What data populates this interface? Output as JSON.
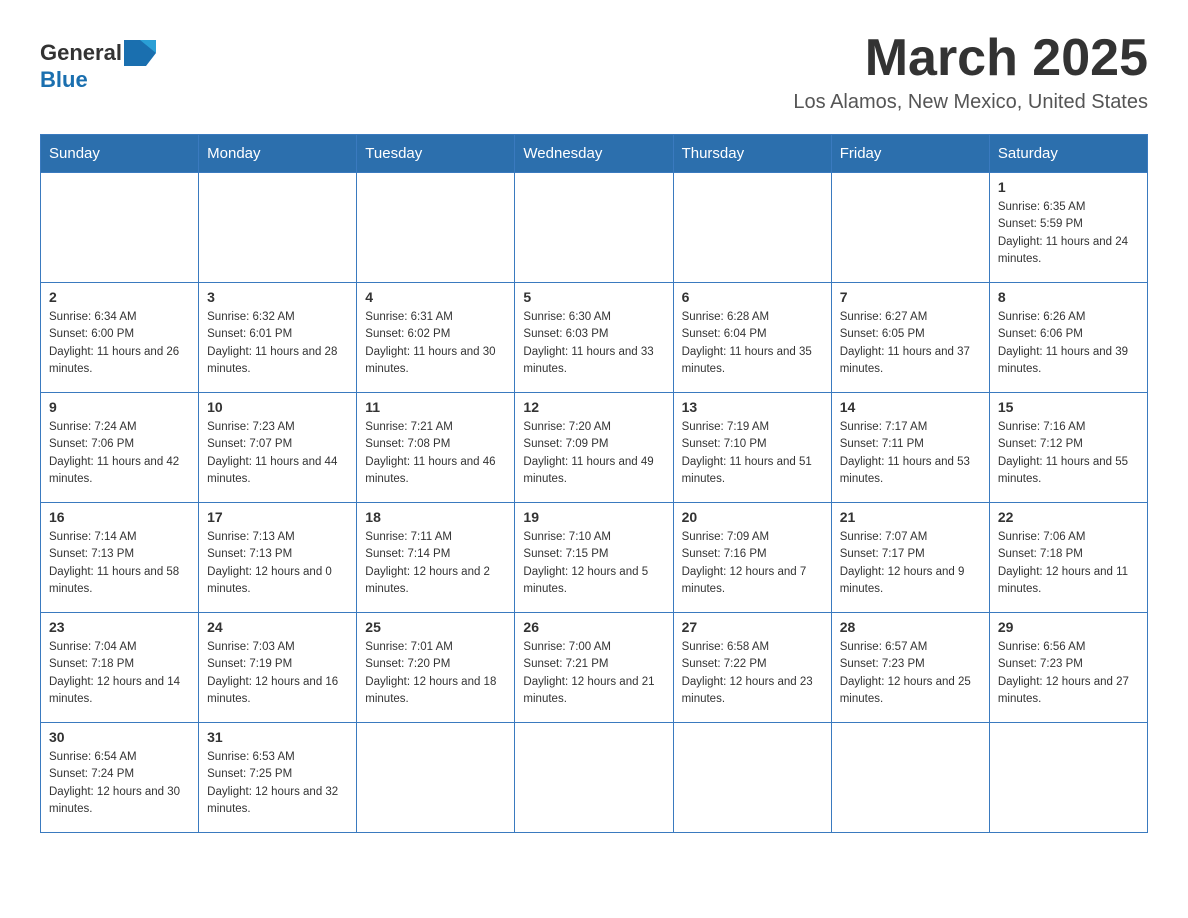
{
  "header": {
    "logo_general": "General",
    "logo_blue": "Blue",
    "month": "March 2025",
    "location": "Los Alamos, New Mexico, United States"
  },
  "weekdays": [
    "Sunday",
    "Monday",
    "Tuesday",
    "Wednesday",
    "Thursday",
    "Friday",
    "Saturday"
  ],
  "weeks": [
    [
      {
        "day": "",
        "sunrise": "",
        "sunset": "",
        "daylight": ""
      },
      {
        "day": "",
        "sunrise": "",
        "sunset": "",
        "daylight": ""
      },
      {
        "day": "",
        "sunrise": "",
        "sunset": "",
        "daylight": ""
      },
      {
        "day": "",
        "sunrise": "",
        "sunset": "",
        "daylight": ""
      },
      {
        "day": "",
        "sunrise": "",
        "sunset": "",
        "daylight": ""
      },
      {
        "day": "",
        "sunrise": "",
        "sunset": "",
        "daylight": ""
      },
      {
        "day": "1",
        "sunrise": "Sunrise: 6:35 AM",
        "sunset": "Sunset: 5:59 PM",
        "daylight": "Daylight: 11 hours and 24 minutes."
      }
    ],
    [
      {
        "day": "2",
        "sunrise": "Sunrise: 6:34 AM",
        "sunset": "Sunset: 6:00 PM",
        "daylight": "Daylight: 11 hours and 26 minutes."
      },
      {
        "day": "3",
        "sunrise": "Sunrise: 6:32 AM",
        "sunset": "Sunset: 6:01 PM",
        "daylight": "Daylight: 11 hours and 28 minutes."
      },
      {
        "day": "4",
        "sunrise": "Sunrise: 6:31 AM",
        "sunset": "Sunset: 6:02 PM",
        "daylight": "Daylight: 11 hours and 30 minutes."
      },
      {
        "day": "5",
        "sunrise": "Sunrise: 6:30 AM",
        "sunset": "Sunset: 6:03 PM",
        "daylight": "Daylight: 11 hours and 33 minutes."
      },
      {
        "day": "6",
        "sunrise": "Sunrise: 6:28 AM",
        "sunset": "Sunset: 6:04 PM",
        "daylight": "Daylight: 11 hours and 35 minutes."
      },
      {
        "day": "7",
        "sunrise": "Sunrise: 6:27 AM",
        "sunset": "Sunset: 6:05 PM",
        "daylight": "Daylight: 11 hours and 37 minutes."
      },
      {
        "day": "8",
        "sunrise": "Sunrise: 6:26 AM",
        "sunset": "Sunset: 6:06 PM",
        "daylight": "Daylight: 11 hours and 39 minutes."
      }
    ],
    [
      {
        "day": "9",
        "sunrise": "Sunrise: 7:24 AM",
        "sunset": "Sunset: 7:06 PM",
        "daylight": "Daylight: 11 hours and 42 minutes."
      },
      {
        "day": "10",
        "sunrise": "Sunrise: 7:23 AM",
        "sunset": "Sunset: 7:07 PM",
        "daylight": "Daylight: 11 hours and 44 minutes."
      },
      {
        "day": "11",
        "sunrise": "Sunrise: 7:21 AM",
        "sunset": "Sunset: 7:08 PM",
        "daylight": "Daylight: 11 hours and 46 minutes."
      },
      {
        "day": "12",
        "sunrise": "Sunrise: 7:20 AM",
        "sunset": "Sunset: 7:09 PM",
        "daylight": "Daylight: 11 hours and 49 minutes."
      },
      {
        "day": "13",
        "sunrise": "Sunrise: 7:19 AM",
        "sunset": "Sunset: 7:10 PM",
        "daylight": "Daylight: 11 hours and 51 minutes."
      },
      {
        "day": "14",
        "sunrise": "Sunrise: 7:17 AM",
        "sunset": "Sunset: 7:11 PM",
        "daylight": "Daylight: 11 hours and 53 minutes."
      },
      {
        "day": "15",
        "sunrise": "Sunrise: 7:16 AM",
        "sunset": "Sunset: 7:12 PM",
        "daylight": "Daylight: 11 hours and 55 minutes."
      }
    ],
    [
      {
        "day": "16",
        "sunrise": "Sunrise: 7:14 AM",
        "sunset": "Sunset: 7:13 PM",
        "daylight": "Daylight: 11 hours and 58 minutes."
      },
      {
        "day": "17",
        "sunrise": "Sunrise: 7:13 AM",
        "sunset": "Sunset: 7:13 PM",
        "daylight": "Daylight: 12 hours and 0 minutes."
      },
      {
        "day": "18",
        "sunrise": "Sunrise: 7:11 AM",
        "sunset": "Sunset: 7:14 PM",
        "daylight": "Daylight: 12 hours and 2 minutes."
      },
      {
        "day": "19",
        "sunrise": "Sunrise: 7:10 AM",
        "sunset": "Sunset: 7:15 PM",
        "daylight": "Daylight: 12 hours and 5 minutes."
      },
      {
        "day": "20",
        "sunrise": "Sunrise: 7:09 AM",
        "sunset": "Sunset: 7:16 PM",
        "daylight": "Daylight: 12 hours and 7 minutes."
      },
      {
        "day": "21",
        "sunrise": "Sunrise: 7:07 AM",
        "sunset": "Sunset: 7:17 PM",
        "daylight": "Daylight: 12 hours and 9 minutes."
      },
      {
        "day": "22",
        "sunrise": "Sunrise: 7:06 AM",
        "sunset": "Sunset: 7:18 PM",
        "daylight": "Daylight: 12 hours and 11 minutes."
      }
    ],
    [
      {
        "day": "23",
        "sunrise": "Sunrise: 7:04 AM",
        "sunset": "Sunset: 7:18 PM",
        "daylight": "Daylight: 12 hours and 14 minutes."
      },
      {
        "day": "24",
        "sunrise": "Sunrise: 7:03 AM",
        "sunset": "Sunset: 7:19 PM",
        "daylight": "Daylight: 12 hours and 16 minutes."
      },
      {
        "day": "25",
        "sunrise": "Sunrise: 7:01 AM",
        "sunset": "Sunset: 7:20 PM",
        "daylight": "Daylight: 12 hours and 18 minutes."
      },
      {
        "day": "26",
        "sunrise": "Sunrise: 7:00 AM",
        "sunset": "Sunset: 7:21 PM",
        "daylight": "Daylight: 12 hours and 21 minutes."
      },
      {
        "day": "27",
        "sunrise": "Sunrise: 6:58 AM",
        "sunset": "Sunset: 7:22 PM",
        "daylight": "Daylight: 12 hours and 23 minutes."
      },
      {
        "day": "28",
        "sunrise": "Sunrise: 6:57 AM",
        "sunset": "Sunset: 7:23 PM",
        "daylight": "Daylight: 12 hours and 25 minutes."
      },
      {
        "day": "29",
        "sunrise": "Sunrise: 6:56 AM",
        "sunset": "Sunset: 7:23 PM",
        "daylight": "Daylight: 12 hours and 27 minutes."
      }
    ],
    [
      {
        "day": "30",
        "sunrise": "Sunrise: 6:54 AM",
        "sunset": "Sunset: 7:24 PM",
        "daylight": "Daylight: 12 hours and 30 minutes."
      },
      {
        "day": "31",
        "sunrise": "Sunrise: 6:53 AM",
        "sunset": "Sunset: 7:25 PM",
        "daylight": "Daylight: 12 hours and 32 minutes."
      },
      {
        "day": "",
        "sunrise": "",
        "sunset": "",
        "daylight": ""
      },
      {
        "day": "",
        "sunrise": "",
        "sunset": "",
        "daylight": ""
      },
      {
        "day": "",
        "sunrise": "",
        "sunset": "",
        "daylight": ""
      },
      {
        "day": "",
        "sunrise": "",
        "sunset": "",
        "daylight": ""
      },
      {
        "day": "",
        "sunrise": "",
        "sunset": "",
        "daylight": ""
      }
    ]
  ]
}
